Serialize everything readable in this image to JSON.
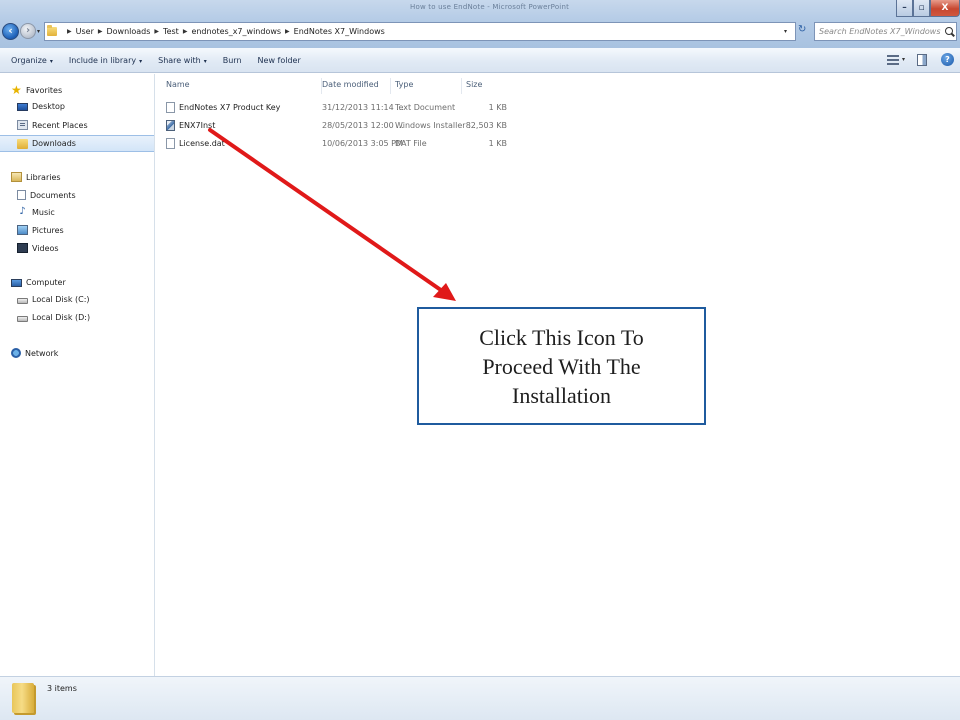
{
  "window": {
    "caption": "How to use EndNote - Microsoft PowerPoint",
    "minimize_glyph": "–",
    "maximize_glyph": "▫",
    "close_glyph": "X"
  },
  "address": {
    "crumbs": [
      "User",
      "Downloads",
      "Test",
      "endnotes_x7_windows",
      "EndNotes X7_Windows"
    ],
    "back_glyph": "‹",
    "forward_glyph": "›",
    "history_glyph": "▾",
    "dropdown_glyph": "▾",
    "refresh_glyph": "↻"
  },
  "search": {
    "placeholder": "Search EndNotes X7_Windows"
  },
  "toolbar": {
    "organize": "Organize",
    "include_in_library": "Include in library",
    "share_with": "Share with",
    "burn": "Burn",
    "new_folder": "New folder",
    "caret": "▾",
    "help_glyph": "?"
  },
  "nav": {
    "favorites": "Favorites",
    "desktop": "Desktop",
    "recent_places": "Recent Places",
    "downloads": "Downloads",
    "libraries": "Libraries",
    "documents": "Documents",
    "music": "Music",
    "pictures": "Pictures",
    "videos": "Videos",
    "computer": "Computer",
    "local_disk_c": "Local Disk (C:)",
    "local_disk_d": "Local Disk (D:)",
    "network": "Network",
    "star_glyph": "★",
    "music_glyph": "♪"
  },
  "columns": {
    "name": "Name",
    "date_modified": "Date modified",
    "type": "Type",
    "size": "Size"
  },
  "files": [
    {
      "name": "EndNotes X7 Product Key",
      "date": "31/12/2013 11:14 ...",
      "type": "Text Document",
      "size": "1 KB"
    },
    {
      "name": "ENX7Inst",
      "date": "28/05/2013 12:00 ...",
      "type": "Windows Installer ...",
      "size": "82,503 KB"
    },
    {
      "name": "License.dat",
      "date": "10/06/2013 3:05 PM",
      "type": "DAT File",
      "size": "1 KB"
    }
  ],
  "status": {
    "item_count": "3 items"
  },
  "annotation": {
    "text": "Click This Icon To Proceed With The Installation",
    "arrow_color": "#e01919",
    "border_color": "#1f5b9e"
  }
}
